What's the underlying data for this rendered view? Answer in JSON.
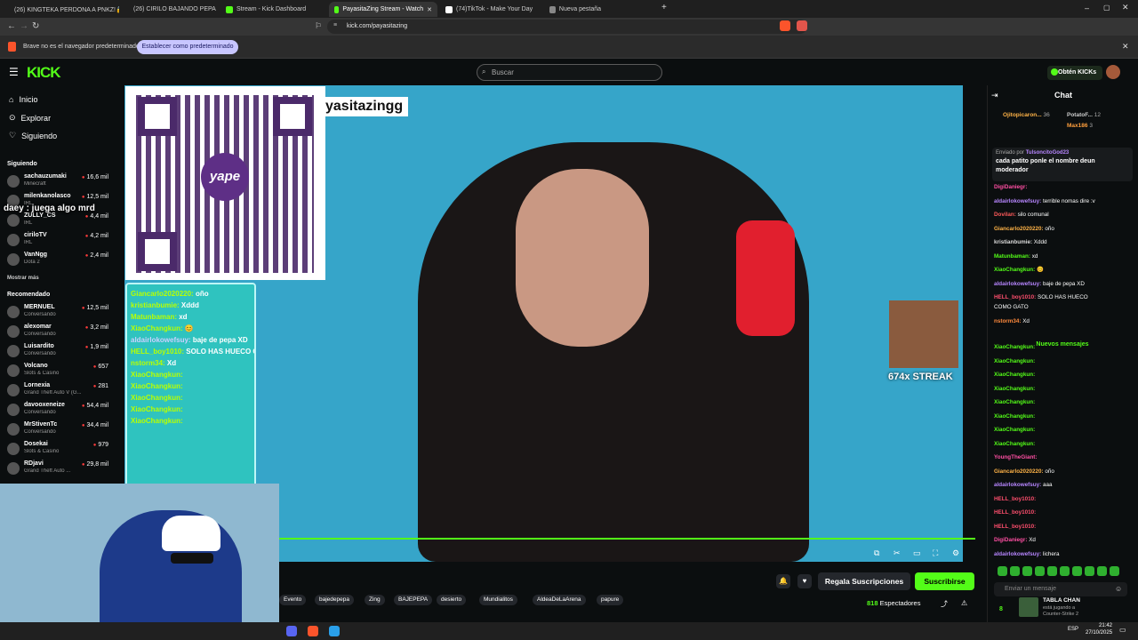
{
  "browser": {
    "tabs": [
      {
        "label": "(26) KINGTEKA PERDONA A PNKZ!🔒",
        "color": "#e3342f"
      },
      {
        "label": "(26) CIRILO BAJANDO PEPA CON",
        "color": "#e3342f"
      },
      {
        "label": "Stream - Kick Dashboard",
        "color": "#53fc18"
      },
      {
        "label": "PayasitaZing Stream - Watch",
        "color": "#53fc18"
      },
      {
        "label": "(74)TikTok - Make Your Day",
        "color": "#ffffff"
      },
      {
        "label": "Nueva pestaña",
        "color": "#888888"
      }
    ],
    "url": "kick.com/payasitazing",
    "infobar_text": "Brave no es el navegador predeterminado",
    "set_default_label": "Establecer como predeterminado"
  },
  "header": {
    "logo": "KICK",
    "search_placeholder": "Buscar",
    "kicks_button": "Obtén KICKs"
  },
  "sidebar": {
    "nav": [
      {
        "label": "Inicio",
        "icon": "home-icon"
      },
      {
        "label": "Explorar",
        "icon": "compass-icon"
      },
      {
        "label": "Siguiendo",
        "icon": "heart-icon"
      }
    ],
    "following_title": "Siguiendo",
    "following": [
      {
        "name": "sachauzumaki",
        "game": "Minecraft",
        "viewers": "16,6 mil"
      },
      {
        "name": "milenkanolasco",
        "game": "IRL",
        "viewers": "12,5 mil"
      },
      {
        "name": "ZULLY_CS",
        "game": "IRL",
        "viewers": "4,4 mil"
      },
      {
        "name": "ciriloTV",
        "game": "IRL",
        "viewers": "4,2 mil"
      },
      {
        "name": "VanNgg",
        "game": "Dota 2",
        "viewers": "2,4 mil"
      }
    ],
    "show_more": "Mostrar más",
    "recommended_title": "Recomendado",
    "recommended": [
      {
        "name": "MERNUEL",
        "game": "Conversando",
        "viewers": "12,5 mil"
      },
      {
        "name": "alexomar",
        "game": "Conversando",
        "viewers": "3,2 mil"
      },
      {
        "name": "Luisardito",
        "game": "Conversando",
        "viewers": "1,9 mil"
      },
      {
        "name": "Volcano",
        "game": "Slots & Casino",
        "viewers": "657"
      },
      {
        "name": "Lornexia",
        "game": "Grand Theft Auto V (G...",
        "viewers": "281"
      },
      {
        "name": "davooxeneize",
        "game": "Conversando",
        "viewers": "54,4 mil"
      },
      {
        "name": "MrStivenTc",
        "game": "Conversando",
        "viewers": "34,4 mil"
      },
      {
        "name": "Dosekai",
        "game": "Slots & Casino",
        "viewers": "979"
      },
      {
        "name": "RDjavi",
        "game": "Grand Theft Auto ...",
        "viewers": "29,8 mil"
      }
    ]
  },
  "video": {
    "streamer_tag": "yasitazingg",
    "qr_brand": "yape",
    "caption": "daey : juega algo mrd",
    "streak": "674x STREAK",
    "overlay_chat": [
      {
        "user": "Giancarlo2020220:",
        "msg": "oño"
      },
      {
        "user": "kristianbumie:",
        "msg": "Xddd"
      },
      {
        "user": "Matunbaman:",
        "msg": "xd"
      },
      {
        "user": "XiaoChangkun:",
        "msg": "😊"
      },
      {
        "user": "aldairlokowefsuy:",
        "msg": "baje de pepa XD"
      },
      {
        "user": "HELL_boy1010:",
        "msg": "SOLO HAS HUECO COMO GATO"
      },
      {
        "user": "nstorm34:",
        "msg": "Xd"
      },
      {
        "user": "XiaoChangkun:",
        "msg": ""
      },
      {
        "user": "XiaoChangkun:",
        "msg": ""
      },
      {
        "user": "XiaoChangkun:",
        "msg": ""
      },
      {
        "user": "XiaoChangkun:",
        "msg": ""
      },
      {
        "user": "XiaoChangkun:",
        "msg": ""
      }
    ]
  },
  "below_video": {
    "tags": [
      "Evento",
      "bajedepepa",
      "Zing",
      "BAJEPEPA",
      "desierto",
      "Mundialitos",
      "AldeaDeLaArena",
      "papure"
    ],
    "gift_subs": "Regala Suscripciones",
    "subscribe": "Suscribirse",
    "viewer_count": "818",
    "viewer_label": "Espectadores"
  },
  "chat": {
    "title": "Chat",
    "top_gifters": [
      {
        "name": "Ojitopicaron...",
        "count": "36"
      },
      {
        "name": "PotatoF...",
        "count": "12"
      },
      {
        "name": "Max186",
        "count": "3"
      }
    ],
    "pinned_by_label": "Enviado por",
    "pinned_by": "TulsoncitoGod23",
    "pinned_text": "cada patito ponle el nombre deun moderador",
    "new_messages": "Nuevos mensajes",
    "messages": [
      {
        "user": "DigiDaniegr:",
        "msg": "",
        "color": "#ff4fa3"
      },
      {
        "user": "aldairlokowefsuy:",
        "msg": "terrible nomas dire :v",
        "color": "#b786ff"
      },
      {
        "user": "Dovilan:",
        "msg": "silo comunal",
        "color": "#ff5a5a"
      },
      {
        "user": "Giancarlo2020220:",
        "msg": "oño",
        "color": "#ffb347"
      },
      {
        "user": "kristianbumie:",
        "msg": "Xddd",
        "color": "#dddddd"
      },
      {
        "user": "Matunbaman:",
        "msg": "xd",
        "color": "#53fc18"
      },
      {
        "user": "XiaoChangkun:",
        "msg": "😊",
        "color": "#53fc18"
      },
      {
        "user": "aldairlokowefsuy:",
        "msg": "baje de pepa XD",
        "color": "#b786ff"
      },
      {
        "user": "HELL_boy1010:",
        "msg": "SOLO HAS HUECO",
        "color": "#ff4f6e"
      },
      {
        "user": "",
        "msg": "COMO GATO",
        "color": "#ffffff"
      },
      {
        "user": "nstorm34:",
        "msg": "Xd",
        "color": "#ff8a3d"
      },
      {
        "user": "XiaoChangkun:",
        "msg": "",
        "color": "#53fc18"
      },
      {
        "user": "XiaoChangkun:",
        "msg": "",
        "color": "#53fc18"
      },
      {
        "user": "XiaoChangkun:",
        "msg": "",
        "color": "#53fc18"
      },
      {
        "user": "XiaoChangkun:",
        "msg": "",
        "color": "#53fc18"
      },
      {
        "user": "XiaoChangkun:",
        "msg": "",
        "color": "#53fc18"
      },
      {
        "user": "XiaoChangkun:",
        "msg": "",
        "color": "#53fc18"
      },
      {
        "user": "XiaoChangkun:",
        "msg": "",
        "color": "#53fc18"
      },
      {
        "user": "XiaoChangkun:",
        "msg": "",
        "color": "#53fc18"
      },
      {
        "user": "YoungTheGiant:",
        "msg": "",
        "color": "#ff4fa3"
      },
      {
        "user": "Giancarlo2020220:",
        "msg": "oño",
        "color": "#ffb347"
      },
      {
        "user": "aldairlokowefsuy:",
        "msg": "aaa",
        "color": "#b786ff"
      },
      {
        "user": "HELL_boy1010:",
        "msg": "",
        "color": "#ff4f6e"
      },
      {
        "user": "HELL_boy1010:",
        "msg": "",
        "color": "#ff4f6e"
      },
      {
        "user": "HELL_boy1010:",
        "msg": "",
        "color": "#ff4f6e"
      },
      {
        "user": "DigiDaniegr:",
        "msg": "Xd",
        "color": "#ff4fa3"
      },
      {
        "user": "aldairlokowefsuy:",
        "msg": "lichera",
        "color": "#b786ff"
      }
    ],
    "input_placeholder": "Enviar un mensaje",
    "points": "8",
    "now_playing_name": "TABLA CHAN",
    "now_playing_sub": "está jugando a Counter-Strike 2"
  },
  "taskbar": {
    "lang": "ESP",
    "time": "21:42",
    "date": "27/10/2025"
  }
}
